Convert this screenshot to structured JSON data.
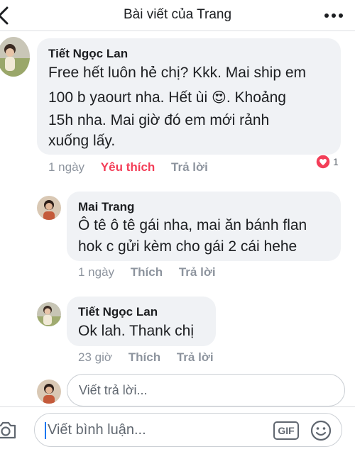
{
  "header": {
    "title": "Bài viết của Trang"
  },
  "comments": [
    {
      "author": "Tiết Ngọc Lan",
      "lines": [
        "Free hết luôn hẻ chị? Kkk. Mai ship em",
        "100 b yaourt nha. Hết ùi",
        "Khoảng",
        "15h nha. Mai giờ đó em mới rảnh",
        "xuống lấy."
      ],
      "emoji": "😍",
      "time": "1 ngày",
      "like_label": "Yêu thích",
      "reply_label": "Trả lời",
      "reaction_count": "1"
    },
    {
      "author": "Mai Trang",
      "lines": [
        "Ô tê ô tê gái nha, mai ăn bánh flan",
        "hok c gửi kèm cho gái 2 cái hehe"
      ],
      "time": "1 ngày",
      "like_label": "Thích",
      "reply_label": "Trả lời"
    },
    {
      "author": "Tiết Ngọc Lan",
      "lines": [
        "Ok lah. Thank chị"
      ],
      "time": "23 giờ",
      "like_label": "Thích",
      "reply_label": "Trả lời"
    }
  ],
  "reply_input": {
    "placeholder": "Viết trả lời..."
  },
  "comment_bar": {
    "placeholder": "Viết bình luận...",
    "gif_label": "GIF"
  },
  "colors": {
    "bubble": "#f0f2f5",
    "liked": "#f33e58",
    "meta": "#8d949e",
    "accent": "#1877f2"
  }
}
